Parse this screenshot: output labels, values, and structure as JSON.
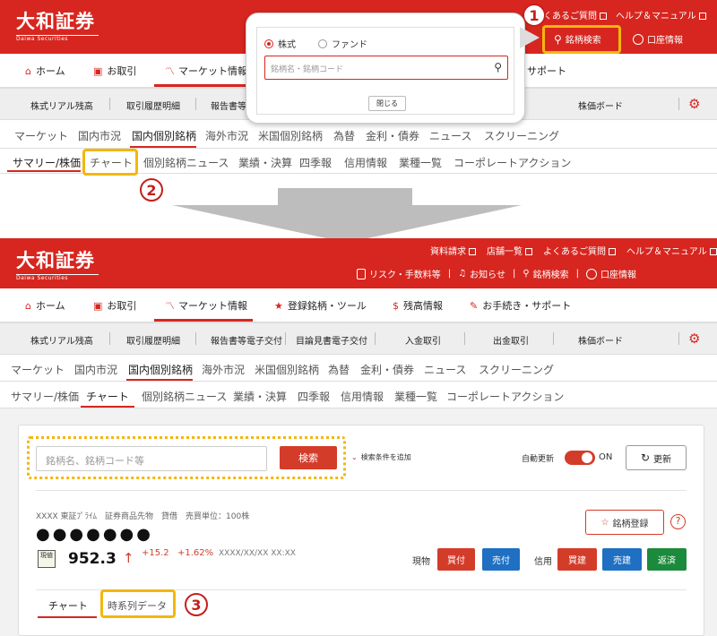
{
  "brand": {
    "name": "大和証券",
    "sub": "Daiwa Securities"
  },
  "header_links": [
    "資料請求",
    "店舗一覧",
    "よくあるご質問",
    "ヘルプ＆マニュアル"
  ],
  "header_util": {
    "risk": "リスク・手数料等",
    "notice": "お知らせ",
    "search": "銘柄検索",
    "account": "口座情報"
  },
  "main_nav": [
    "ホーム",
    "お取引",
    "マーケット情報",
    "登録銘柄・ツール",
    "残高情報",
    "お手続き・サポート"
  ],
  "main_nav_top": [
    "ホーム",
    "お取引",
    "マーケット情報",
    "サポート"
  ],
  "sub_nav": [
    "株式リアル残高",
    "取引履歴明細",
    "報告書等電子交付",
    "目論見書電子交付",
    "入金取引",
    "出金取引",
    "株価ボード"
  ],
  "sub_nav_top": [
    "株式リアル残高",
    "取引履歴明細",
    "報告書等",
    "株価ボード"
  ],
  "tabs1": [
    "マーケット",
    "国内市況",
    "国内個別銘柄",
    "海外市況",
    "米国個別銘柄",
    "為替",
    "金利・債券",
    "ニュース",
    "スクリーニング"
  ],
  "tabs2": [
    "サマリー/株価",
    "チャート",
    "個別銘柄ニュース",
    "業績・決算",
    "四季報",
    "信用情報",
    "業種一覧",
    "コーポレートアクション"
  ],
  "popup": {
    "radio1": "株式",
    "radio2": "ファンド",
    "placeholder": "銘柄名・銘柄コード",
    "close": "閉じる"
  },
  "markers": [
    "1",
    "2",
    "3"
  ],
  "search_box": {
    "placeholder": "銘柄名、銘柄コード等",
    "button": "検索",
    "add_cond": "検索条件を追加",
    "auto_label": "自動更新",
    "toggle": "ON",
    "refresh": "更新"
  },
  "stock": {
    "meta": "XXXX 東証ﾌﾟﾗｲﾑ　証券商品先物　貸借　売買単位：100株",
    "name_dots": "●●●●●●●",
    "tag": "現値",
    "price": "952.3",
    "arrow": "↑",
    "change": "+15.2",
    "pct": "+1.62%",
    "time": "XXXX/XX/XX XX:XX",
    "register": "銘柄登録",
    "help": "?"
  },
  "trade": {
    "genbutsu": "現物",
    "buy": "買付",
    "sell": "売付",
    "shinyo": "信用",
    "shin_buy": "買建",
    "shin_sell": "売建",
    "return": "返済"
  },
  "bottom_tabs": [
    "チャート",
    "時系列データ"
  ],
  "colors": {
    "brand_red": "#d7261f",
    "highlight": "#f3b70d",
    "buy_red": "#d43c2a",
    "sell_blue": "#1f6fc2",
    "return_green": "#1c8a3c"
  }
}
